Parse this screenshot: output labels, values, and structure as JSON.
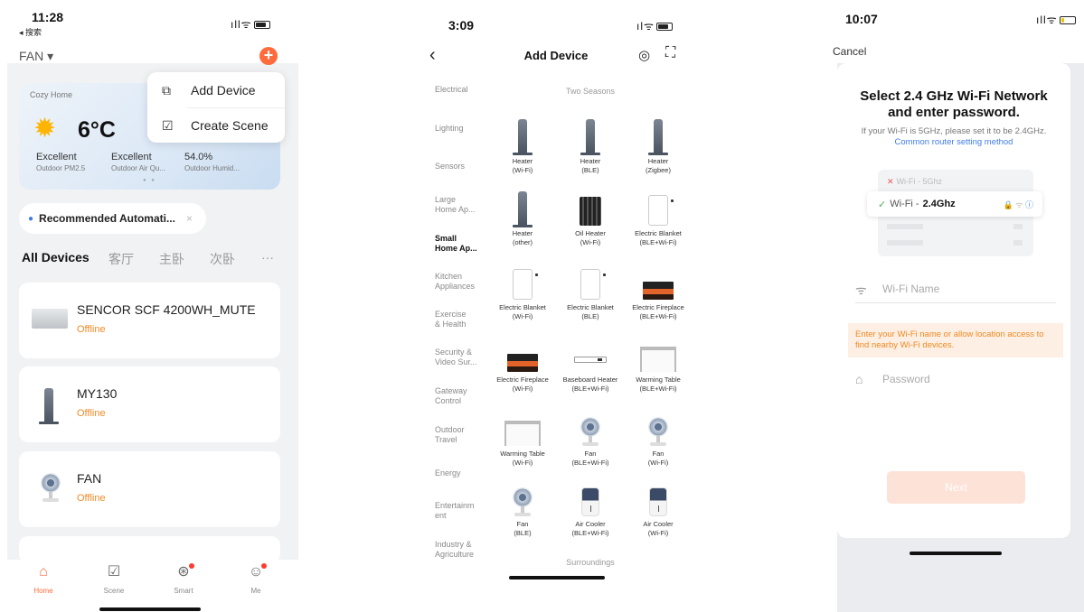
{
  "screen1": {
    "status": {
      "time": "11:28",
      "back_app": "◂ 搜索"
    },
    "home_selector": "FAN ▾",
    "add_button": "+",
    "popup": {
      "items": [
        {
          "label": "Add Device",
          "icon": "add-device-icon"
        },
        {
          "label": "Create Scene",
          "icon": "create-scene-icon"
        }
      ]
    },
    "weather": {
      "home_name": "Cozy Home",
      "temperature": "6°C",
      "stats": [
        {
          "value": "Excellent",
          "label": "Outdoor PM2.5"
        },
        {
          "value": "Excellent",
          "label": "Outdoor Air Qu..."
        },
        {
          "value": "54.0%",
          "label": "Outdoor Humid..."
        }
      ]
    },
    "recommended": {
      "label": "Recommended Automati...",
      "close": "×"
    },
    "tabs": [
      "All Devices",
      "客厅",
      "主卧",
      "次卧",
      "···"
    ],
    "devices": [
      {
        "name": "SENCOR SCF 4200WH_MUTE",
        "status": "Offline"
      },
      {
        "name": "MY130",
        "status": "Offline"
      },
      {
        "name": "FAN",
        "status": "Offline"
      }
    ],
    "tabbar": [
      {
        "label": "Home",
        "icon": "home-icon"
      },
      {
        "label": "Scene",
        "icon": "scene-icon"
      },
      {
        "label": "Smart",
        "icon": "smart-icon"
      },
      {
        "label": "Me",
        "icon": "me-icon"
      }
    ],
    "accent": "#ff6b3d"
  },
  "screen2": {
    "status": {
      "time": "3:09"
    },
    "title": "Add Device",
    "categories": [
      "Electrical",
      "Lighting",
      "Sensors",
      "Large\nHome Ap...",
      "Small\nHome Ap...",
      "Kitchen\nAppliances",
      "Exercise\n& Health",
      "Security &\nVideo Sur...",
      "Gateway\nControl",
      "Outdoor\nTravel",
      "Energy",
      "Entertainm\nent",
      "Industry &\nAgriculture"
    ],
    "active_category": "Small\nHome Ap...",
    "section_title": "Two Seasons",
    "section_footer": "Surroundings",
    "devices": [
      {
        "name": "Heater\n(Wi-Fi)",
        "pic": "heater"
      },
      {
        "name": "Heater\n(BLE)",
        "pic": "heater"
      },
      {
        "name": "Heater\n(Zigbee)",
        "pic": "heater"
      },
      {
        "name": "Heater\n(other)",
        "pic": "heater"
      },
      {
        "name": "Oil Heater\n(Wi-Fi)",
        "pic": "oil"
      },
      {
        "name": "Electric Blanket\n(BLE+Wi-Fi)",
        "pic": "blanket"
      },
      {
        "name": "Electric Blanket\n(Wi-Fi)",
        "pic": "blanket"
      },
      {
        "name": "Electric Blanket\n(BLE)",
        "pic": "blanket"
      },
      {
        "name": "Electric Fireplace\n(BLE+Wi-Fi)",
        "pic": "fire"
      },
      {
        "name": "Electric Fireplace\n(Wi-Fi)",
        "pic": "fire"
      },
      {
        "name": "Baseboard Heater\n(BLE+Wi-Fi)",
        "pic": "base"
      },
      {
        "name": "Warming Table\n(BLE+Wi-Fi)",
        "pic": "table"
      },
      {
        "name": "Warming Table\n(Wi-Fi)",
        "pic": "table"
      },
      {
        "name": "Fan\n(BLE+Wi-Fi)",
        "pic": "fan"
      },
      {
        "name": "Fan\n(Wi-Fi)",
        "pic": "fan"
      },
      {
        "name": "Fan\n(BLE)",
        "pic": "fan"
      },
      {
        "name": "Air Cooler\n(BLE+Wi-Fi)",
        "pic": "cooler"
      },
      {
        "name": "Air Cooler\n(Wi-Fi)",
        "pic": "cooler"
      }
    ]
  },
  "screen3": {
    "status": {
      "time": "10:07"
    },
    "cancel": "Cancel",
    "heading": "Select 2.4 GHz Wi-Fi Network\nand enter password.",
    "sub": "If your Wi-Fi is 5GHz, please set it to be 2.4GHz.",
    "link": "Common router setting method",
    "wifi_5g": "Wi-Fi - 5Ghz",
    "wifi_24_prefix": "Wi-Fi -",
    "wifi_24_name": "2.4Ghz",
    "wifi_name_placeholder": "Wi-Fi Name",
    "warning": "Enter your Wi-Fi name or allow location access to find nearby Wi-Fi devices.",
    "password_placeholder": "Password",
    "next": "Next"
  }
}
